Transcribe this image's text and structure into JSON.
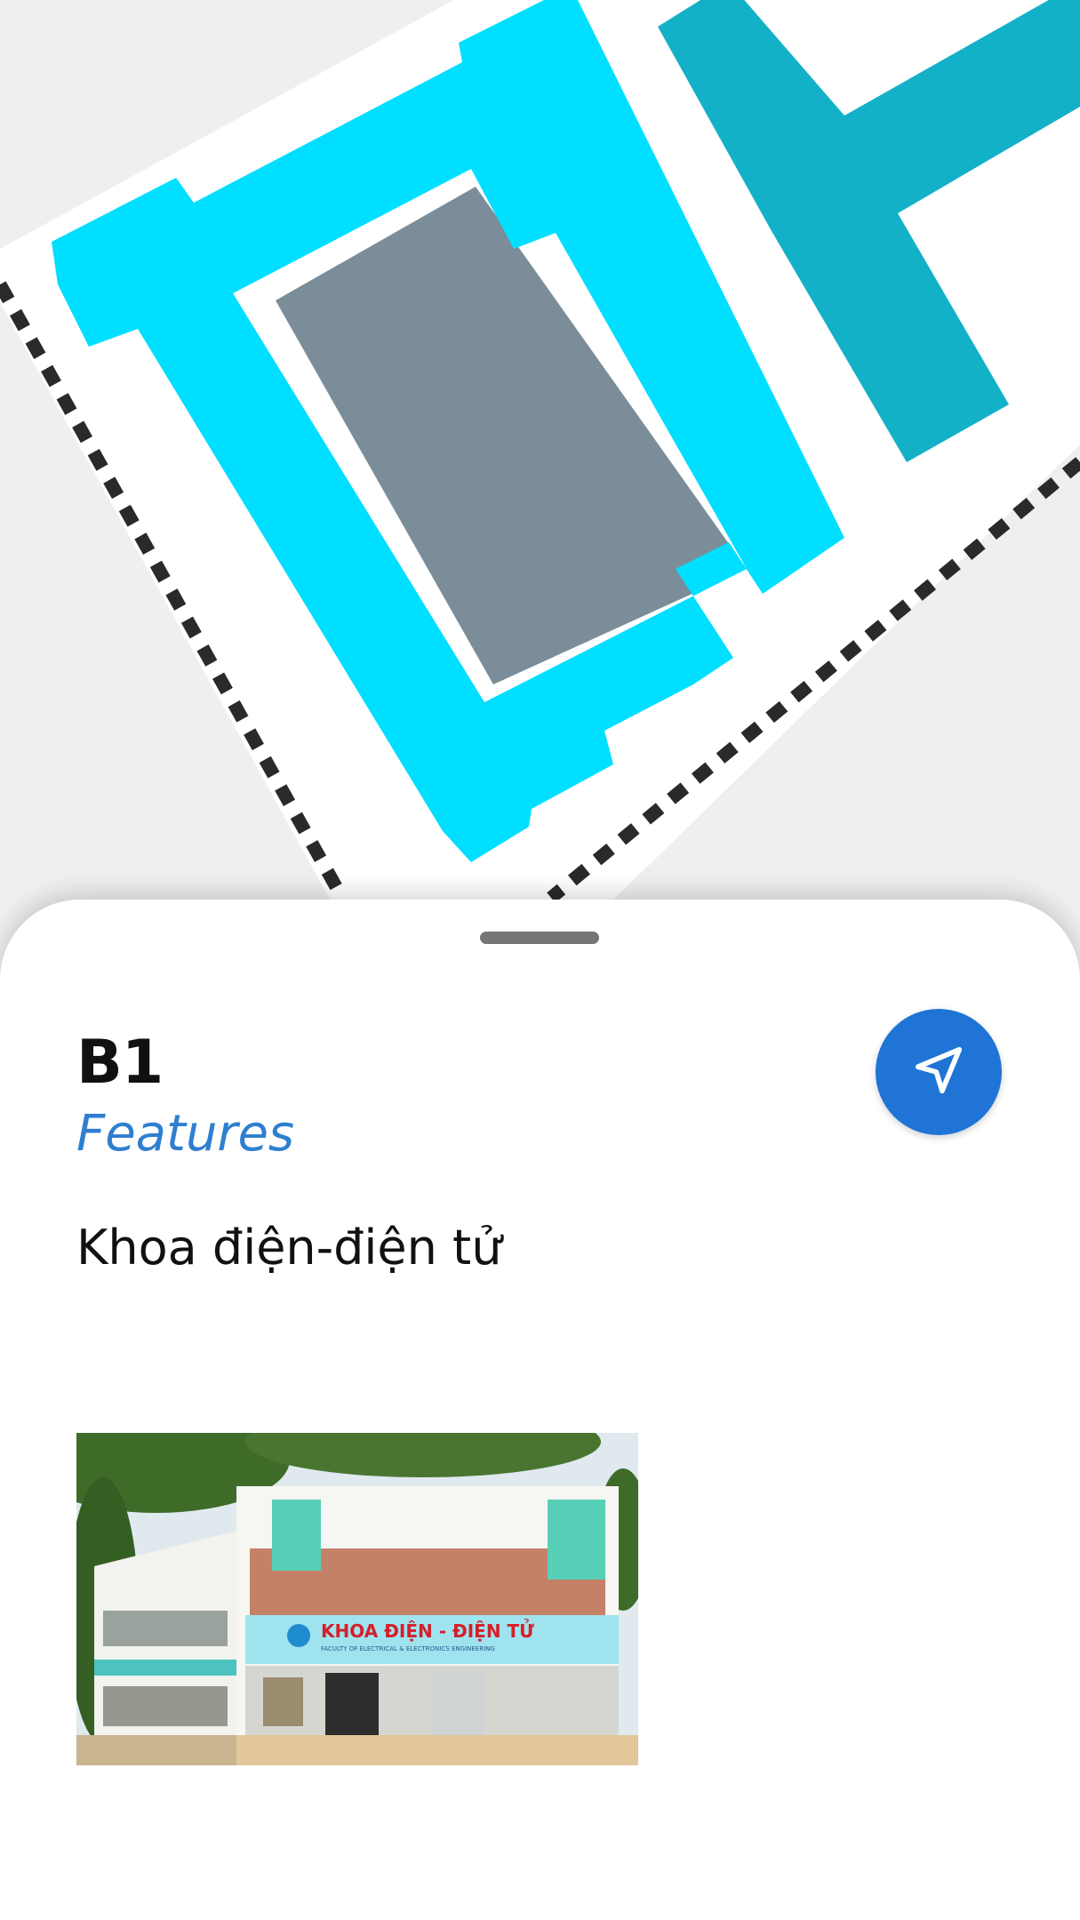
{
  "building": {
    "code": "B1",
    "category": "Features",
    "description": "Khoa điện-điện tử"
  },
  "photo": {
    "sign_main": "KHOA ĐIỆN - ĐIỆN TỬ",
    "sign_sub": "FACULTY OF ELECTRICAL & ELECTRONICS ENGINEERING"
  },
  "icons": {
    "navigate": "navigation-arrow-icon",
    "handle": "drag-handle"
  },
  "colors": {
    "selected_building": "#00dfff",
    "adjacent_building": "#13b1c8",
    "courtyard": "#7a8d99",
    "boundary": "#2a2a2a",
    "map_background": "#efefee",
    "accent": "#1f74d6"
  }
}
